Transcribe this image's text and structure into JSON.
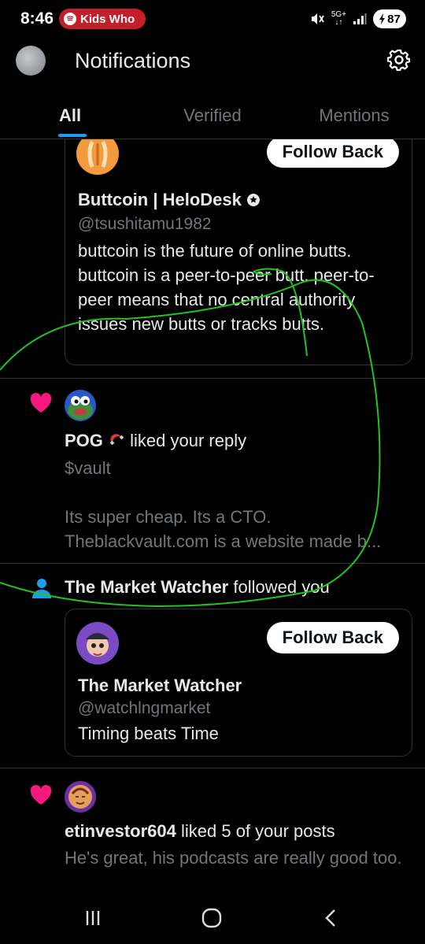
{
  "status": {
    "time": "8:46",
    "media_label": "Kids Who",
    "network": "5G+",
    "battery": "87",
    "accent": "#c41e2a"
  },
  "header": {
    "title": "Notifications",
    "tabs": [
      {
        "label": "All",
        "active": true
      },
      {
        "label": "Verified",
        "active": false
      },
      {
        "label": "Mentions",
        "active": false
      }
    ],
    "accent": "#1d9bf0"
  },
  "notifications": {
    "card1": {
      "follow_label": "Follow Back",
      "name": "Buttcoin | HeloDesk",
      "handle": "@tsushitamu1982",
      "bio": "buttcoin is the future of online butts. buttcoin is a peer-to-peer butt. peer-to-peer means that no central authority issues new butts or tracks butts."
    },
    "like1": {
      "user": "POG",
      "user_icon": "magnet-emoji",
      "action": "liked your reply",
      "post_line1": "$vault",
      "post_line2": "Its super cheap.  Its a CTO.",
      "post_line3": "Theblackvault.com is a website made b..."
    },
    "follow2": {
      "user": "The Market Watcher",
      "action": "followed you",
      "follow_label": "Follow Back",
      "name": "The Market Watcher",
      "handle": "@watchlngmarket",
      "bio": "Timing beats Time"
    },
    "like2": {
      "user": "etinvestor604",
      "action": "liked 5 of your posts",
      "post": "He's great, his podcasts are really good too."
    },
    "like_color": "#f91880"
  },
  "navbar": {
    "recent_icon": "recent-apps-icon",
    "home_icon": "home-icon",
    "back_icon": "back-icon"
  }
}
